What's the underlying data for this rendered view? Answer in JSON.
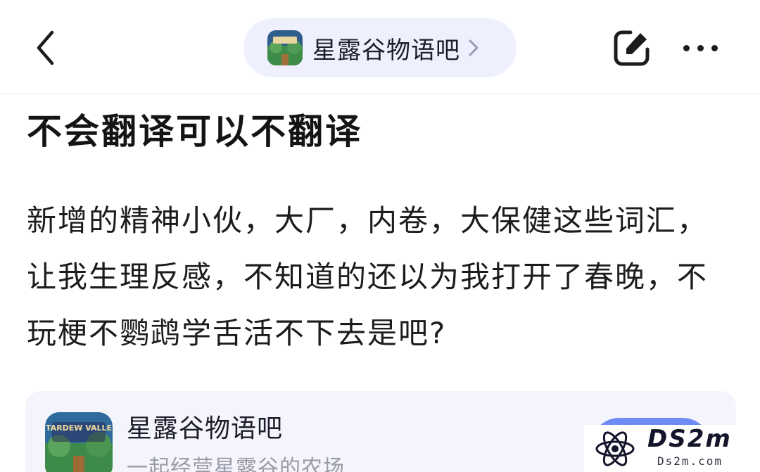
{
  "header": {
    "forum_name": "星露谷物语吧",
    "icons": [
      "back-arrow-icon",
      "chevron-right-icon",
      "edit-icon",
      "more-icon"
    ]
  },
  "post": {
    "title": "不会翻译可以不翻译",
    "body": "新增的精神小伙，大厂，内卷，大保健这些词汇，让我生理反感，不知道的还以为我打开了春晚，不玩梗不鹦鹉学舌活不下去是吧?"
  },
  "forum_card": {
    "name": "星露谷物语吧",
    "description": "一起经营星露谷的农场",
    "logo_text": "STARDEW VALLEY"
  },
  "watermark": {
    "big_text": "DS2m",
    "small_text": "Ds2m.com"
  },
  "colors": {
    "pill_background": "#eef0fd",
    "card_background": "#f4f5fc",
    "join_button": "#6f8cf4",
    "muted_text": "#9a9aa8"
  }
}
